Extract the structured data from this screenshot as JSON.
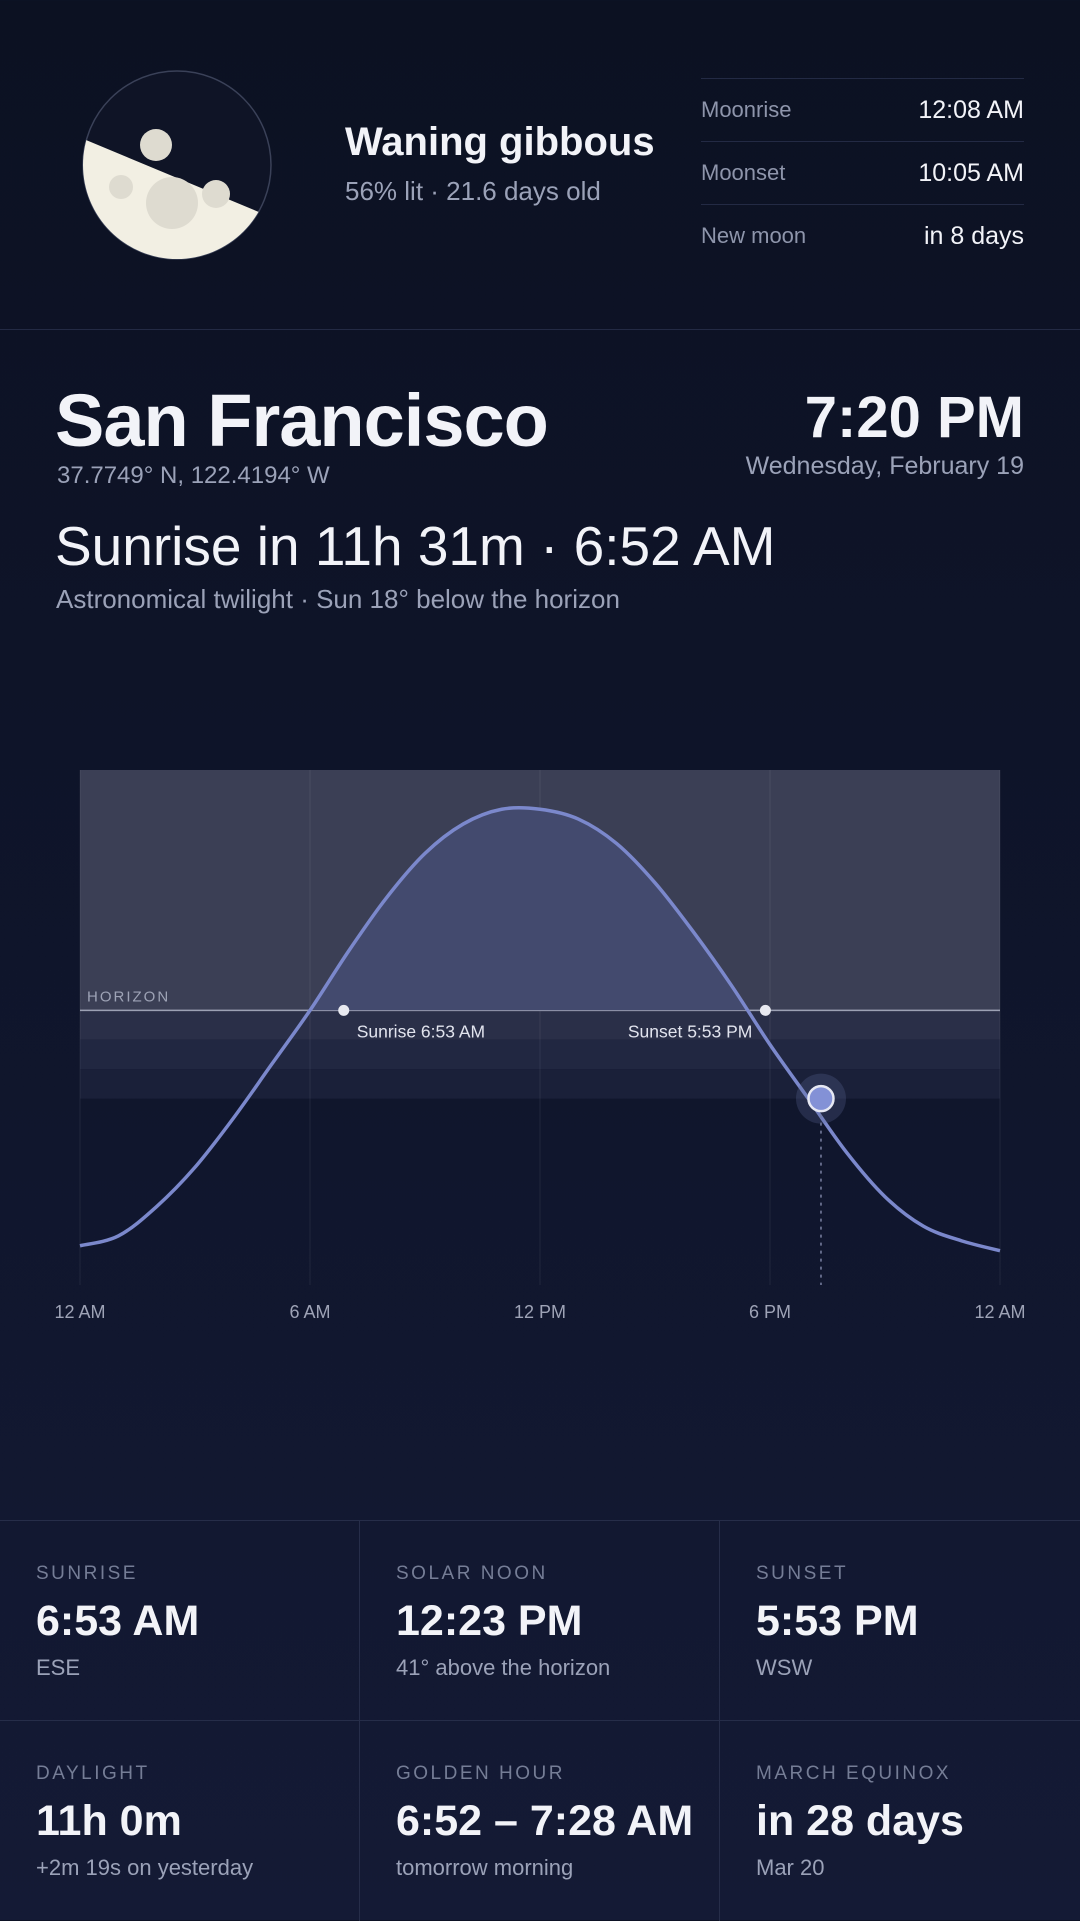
{
  "moon": {
    "phase": "Waning gibbous",
    "detail": "56% lit · 21.6 days old",
    "illumination_percent": 56,
    "rows": [
      {
        "label": "Moonrise",
        "value": "12:08 AM"
      },
      {
        "label": "Moonset",
        "value": "10:05 AM"
      },
      {
        "label": "New moon",
        "value": "in 8 days"
      }
    ]
  },
  "location": {
    "city": "San Francisco",
    "coordinates": "37.7749° N, 122.4194° W"
  },
  "now": {
    "time": "7:20 PM",
    "date": "Wednesday, February 19"
  },
  "headline": "Sunrise in 11h 31m · 6:52 AM",
  "subheadline": "Astronomical twilight · Sun 18° below the horizon",
  "chart_data": {
    "type": "line",
    "title": "",
    "xlabel": "",
    "ylabel": "",
    "x_ticks": [
      "12 AM",
      "6 AM",
      "12 PM",
      "6 PM",
      "12 AM"
    ],
    "x_range_hours": [
      0,
      24
    ],
    "y_range_degrees": [
      -56,
      49
    ],
    "horizon_label": "HORIZON",
    "series": [
      {
        "x_hours": [
          0,
          1,
          2,
          3,
          4,
          5,
          6,
          7,
          8,
          9,
          10,
          11,
          12,
          13,
          14,
          15,
          16,
          17,
          18,
          19,
          20,
          21,
          22,
          23,
          24
        ],
        "altitude_degrees": [
          -48,
          -46,
          -40,
          -32,
          -22,
          -11,
          0,
          12,
          23,
          32,
          38,
          41,
          41,
          39,
          34,
          26,
          16,
          5,
          -7,
          -18,
          -29,
          -38,
          -44,
          -47,
          -49
        ]
      }
    ],
    "events": [
      {
        "label": "Sunrise 6:53 AM",
        "hour": 6.88
      },
      {
        "label": "Sunset 5:53 PM",
        "hour": 17.88
      }
    ],
    "current": {
      "hour": 19.33,
      "altitude_degrees": -18
    },
    "twilight_bands_degrees": [
      -6,
      -12,
      -18
    ],
    "colors": {
      "curve": "#7b88cc",
      "day_fill": "#434a6e",
      "marker": "#8391d6"
    }
  },
  "stats": [
    {
      "label": "SUNRISE",
      "value": "6:53 AM",
      "sub": "ESE"
    },
    {
      "label": "SOLAR NOON",
      "value": "12:23 PM",
      "sub": "41° above the horizon"
    },
    {
      "label": "SUNSET",
      "value": "5:53 PM",
      "sub": "WSW"
    },
    {
      "label": "DAYLIGHT",
      "value": "11h 0m",
      "sub": "+2m 19s on yesterday"
    },
    {
      "label": "GOLDEN HOUR",
      "value": "6:52 – 7:28 AM",
      "sub": "tomorrow morning"
    },
    {
      "label": "MARCH EQUINOX",
      "value": "in 28 days",
      "sub": "Mar 20"
    }
  ]
}
